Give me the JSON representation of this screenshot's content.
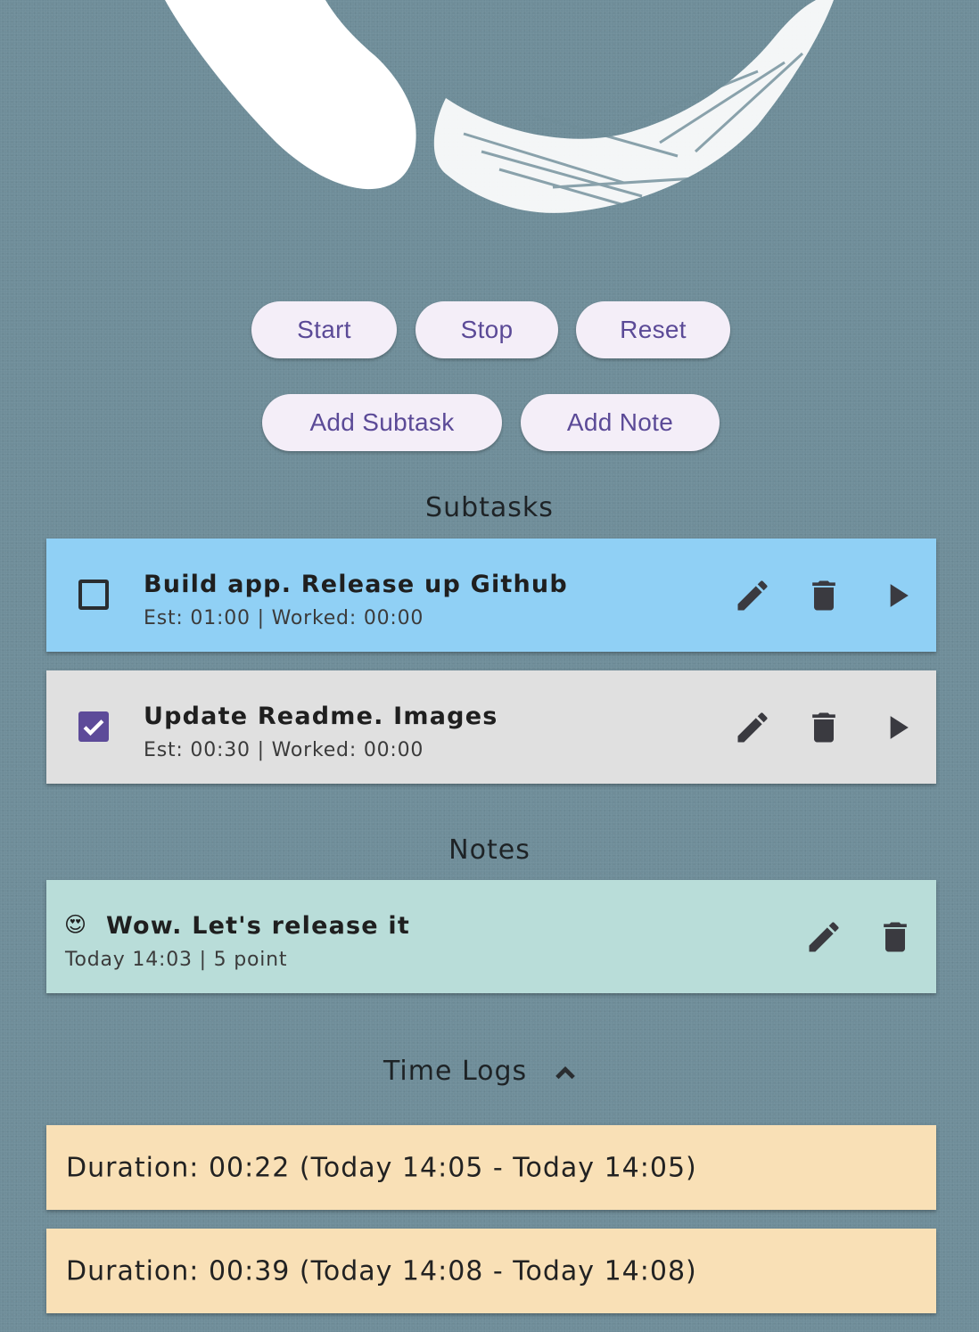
{
  "colors": {
    "background": "#6f8d99",
    "button_bg": "#f4eef8",
    "button_text": "#5b4a97",
    "subtask_active": "#90d0f5",
    "subtask_done": "#e0e0e0",
    "note": "#b9ddd9",
    "log": "#f9e0b6",
    "checkbox_checked": "#5d4b99",
    "icon": "#3a3a40"
  },
  "controls": {
    "start": "Start",
    "stop": "Stop",
    "reset": "Reset",
    "add_subtask": "Add Subtask",
    "add_note": "Add Note"
  },
  "subtasks": {
    "heading": "Subtasks",
    "items": [
      {
        "title": "Build app. Release up Github",
        "meta": "Est: 01:00 | Worked: 00:00",
        "checked": false
      },
      {
        "title": "Update Readme. Images",
        "meta": "Est: 00:30 | Worked: 00:00",
        "checked": true
      }
    ]
  },
  "notes": {
    "heading": "Notes",
    "items": [
      {
        "emoji": "😍",
        "title": "Wow. Let's release it",
        "meta": "Today 14:03 | 5 point"
      }
    ]
  },
  "time_logs": {
    "heading": "Time Logs",
    "expanded": true,
    "items": [
      {
        "text": "Duration: 00:22 (Today 14:05 - Today 14:05)"
      },
      {
        "text": "Duration: 00:39 (Today 14:08 - Today 14:08)"
      }
    ]
  },
  "icons": {
    "edit": "pencil-icon",
    "delete": "trash-icon",
    "play": "play-icon",
    "collapse": "chevron-up-icon",
    "check": "checkmark-icon"
  }
}
